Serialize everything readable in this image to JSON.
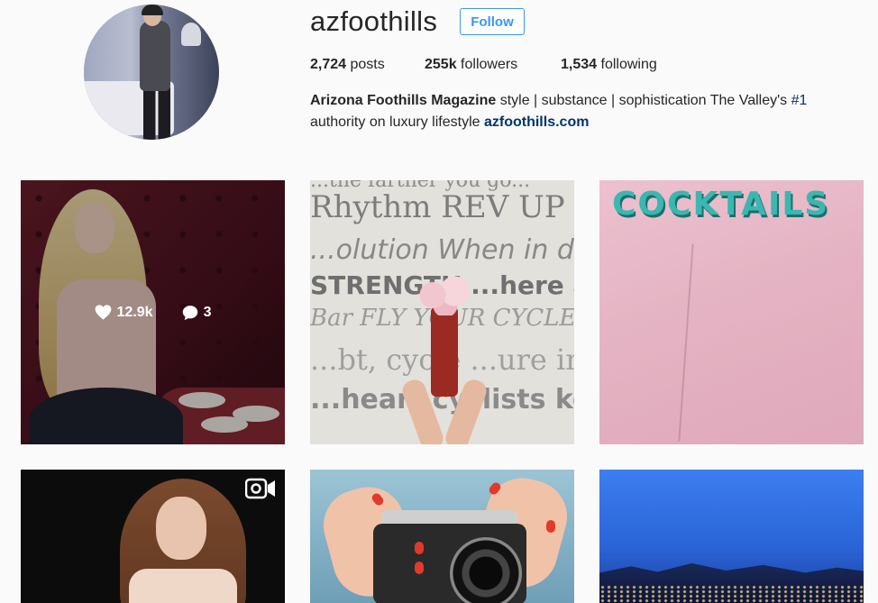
{
  "profile": {
    "username": "azfoothills",
    "follow_label": "Follow",
    "stats": {
      "posts_count": "2,724",
      "posts_label": "posts",
      "followers_count": "255k",
      "followers_label": "followers",
      "following_count": "1,534",
      "following_label": "following"
    },
    "bio": {
      "name": "Arizona Foothills Magazine",
      "text_part1": "style | substance | sophistication The Valley's",
      "hashtag": "#1",
      "text_part2": "authority on luxury lifestyle",
      "link": "azfoothills.com"
    },
    "accent_color": "#3897f0",
    "link_color": "#003569"
  },
  "grid": {
    "posts": [
      {
        "id": "post-1",
        "hover": true,
        "likes": "12.9k",
        "comments": "3",
        "like_icon": "heart-icon",
        "comment_icon": "comment-icon"
      },
      {
        "id": "post-2",
        "text_lines": [
          "...the farther you go...",
          "Rhythm REV UP YOUR",
          "...olution When in doubt",
          "STRENGTH ...here are no sh...",
          "Bar FLY YOUR CYCLE",
          "...bt, cycle ...ure inte...",
          "...heart cyclists keep it..."
        ]
      },
      {
        "id": "post-3",
        "sign_text": "COCKTAILS"
      },
      {
        "id": "post-4",
        "media_type": "video",
        "media_icon": "video-camera-icon"
      },
      {
        "id": "post-5"
      },
      {
        "id": "post-6"
      }
    ]
  }
}
